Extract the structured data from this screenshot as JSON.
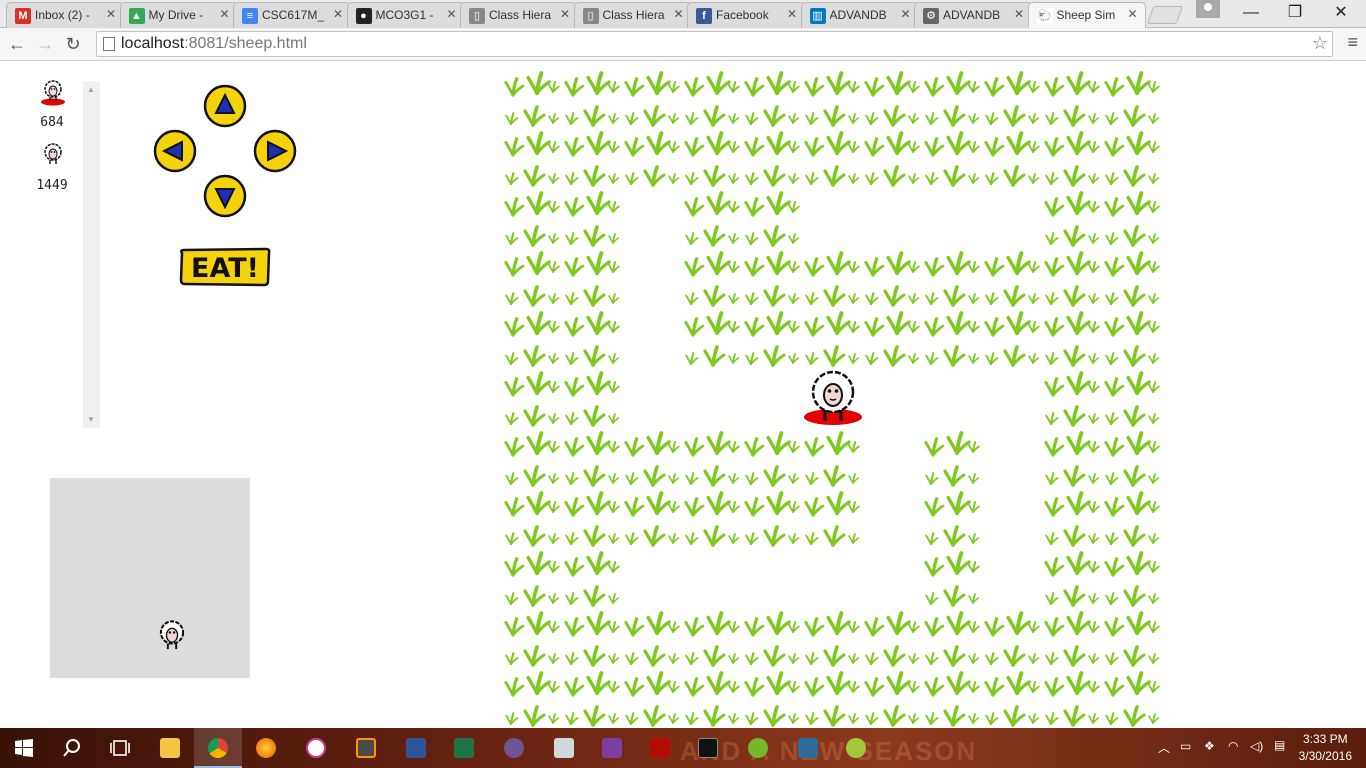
{
  "browser": {
    "tabs": [
      {
        "title": "Inbox (2) -",
        "icon": "gmail-icon",
        "color": "#d93025",
        "glyph": "M"
      },
      {
        "title": "My Drive -",
        "icon": "google-drive-icon",
        "color": "#34a853",
        "glyph": "▲"
      },
      {
        "title": "CSC617M_",
        "icon": "google-docs-icon",
        "color": "#4285f4",
        "glyph": "≡"
      },
      {
        "title": "MCO3G1 -",
        "icon": "github-icon",
        "color": "#222222",
        "glyph": "●"
      },
      {
        "title": "Class Hiera",
        "icon": "page-icon",
        "color": "#888888",
        "glyph": "▯"
      },
      {
        "title": "Class Hiera",
        "icon": "page-icon",
        "color": "#888888",
        "glyph": "▯"
      },
      {
        "title": "Facebook",
        "icon": "facebook-icon",
        "color": "#3b5998",
        "glyph": "f"
      },
      {
        "title": "ADVANDB",
        "icon": "trello-icon",
        "color": "#0079bf",
        "glyph": "▥"
      },
      {
        "title": "ADVANDB",
        "icon": "settings-icon",
        "color": "#666666",
        "glyph": "⚙"
      },
      {
        "title": "Sheep Sim",
        "icon": "sheep-icon",
        "color": "#ffffff",
        "glyph": "🐑"
      }
    ],
    "url_host": "localhost",
    "url_rest": ":8081/sheep.html",
    "window_controls": {
      "minimize": "—",
      "maximize": "❐",
      "close": "✕"
    }
  },
  "game": {
    "scores": [
      {
        "value": "684",
        "highlighted": true
      },
      {
        "value": "1449",
        "highlighted": false
      }
    ],
    "controls": {
      "up": "▲",
      "down": "▼",
      "left": "◀",
      "right": "▶",
      "eat_label": "EAT!"
    },
    "field": {
      "grass_rows": [
        "11111111111",
        "11111111111",
        "11011000011",
        "11011111111",
        "11011111111",
        "11000000011",
        "11111101011",
        "11111101011",
        "11000001011",
        "11111111111",
        "11111111111"
      ],
      "player_cell": [
        5,
        5
      ]
    },
    "colors": {
      "grass": "#7ec81f",
      "sheep_shadow": "#e30000",
      "button_yellow": "#f4d20c",
      "button_arrow": "#1c2fb5",
      "minimap_bg": "#dcdcdc"
    }
  },
  "taskbar": {
    "ad_text": "AND A NEW SEASON",
    "time": "3:33 PM",
    "date": "3/30/2016"
  }
}
